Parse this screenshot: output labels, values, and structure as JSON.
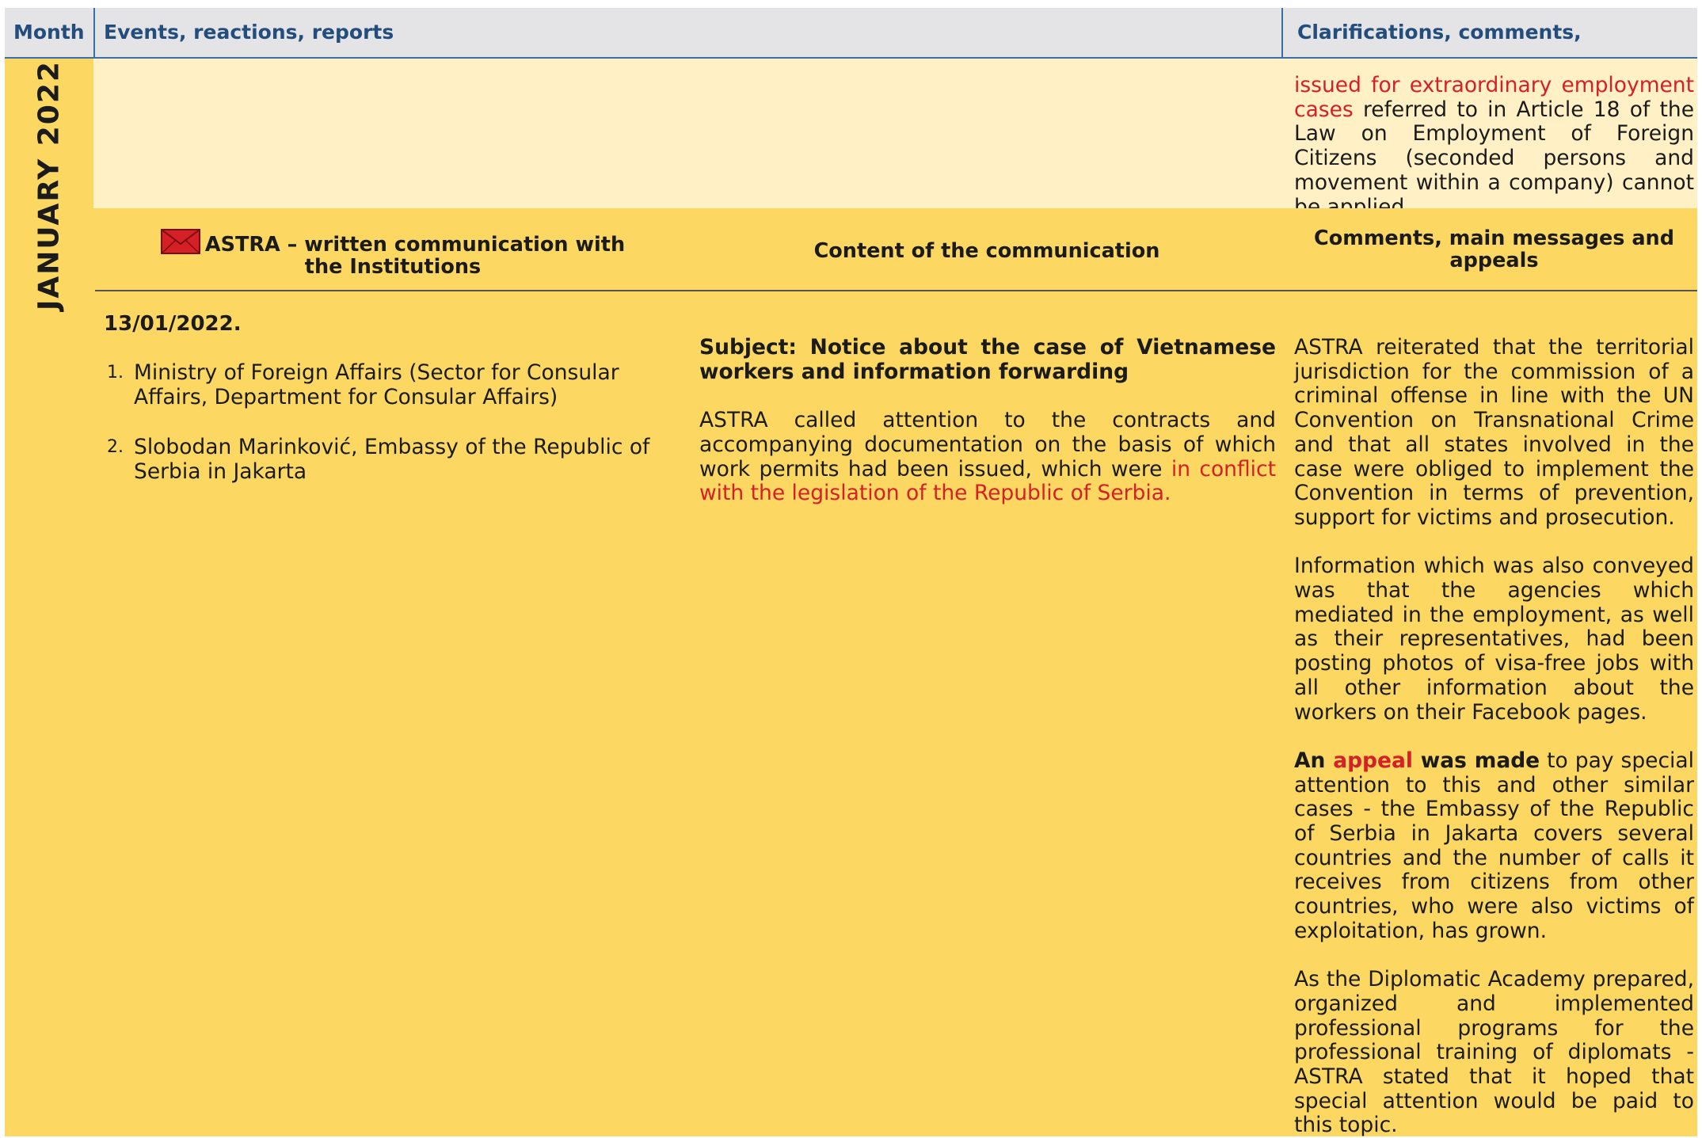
{
  "header": {
    "month": "Month",
    "events": "Events, reactions, reports",
    "clarifications": "Clarifications, comments, responses"
  },
  "month_label": "JANUARY 2022",
  "continuation": {
    "red_text": "issued for extraordinary employment cases",
    "rest_text": " referred to in Article 18 of the Law on Employment of Foreign Citizens (seconded persons and movement within a company) cannot be applied."
  },
  "subheader": {
    "col1": "ASTRA – written communication with the Institutions",
    "col2": "Content of the communication",
    "col3": "Comments, main messages and appeals",
    "icon": "envelope-icon",
    "icon_color": "#d62027"
  },
  "entry": {
    "date": "13/01/2022.",
    "institutions": [
      {
        "num": "1.",
        "text": "Ministry of Foreign Affairs (Sector for Consular Affairs, Department for Consular Affairs)"
      },
      {
        "num": "2.",
        "text": "Slobodan Marinković, Embassy of the Republic of Serbia in Jakarta"
      }
    ],
    "subject": "Subject: Notice about the case of Vietnamese workers and information forwarding",
    "content_text": "ASTRA called attention to the contracts and accompanying documentation on the basis of which work permits had been issued, which were ",
    "content_red": "in conflict with the legislation of the Republic of Serbia.",
    "comments": {
      "p1": "ASTRA reiterated that the territorial jurisdiction for the commission of a criminal offense in line with the UN Convention on Transnational Crime and that all states involved in the case were obliged to implement the Convention in terms of prevention, support for victims and prosecution.",
      "p2": "Information which was also conveyed was that the agencies which mediated in the employment, as well as their representatives, had been posting photos of visa-free jobs with all other information about the workers on their Facebook pages.",
      "p3_bold1": "An ",
      "p3_red": "appeal",
      "p3_bold2": " was made",
      "p3_rest": " to pay special attention to this and other similar cases - the Embassy of the Republic of Serbia in Jakarta covers several countries and the number of calls it receives from citizens from other countries, who were also victims of exploitation, has grown.",
      "p4": "As the Diplomatic Academy prepared, organized and implemented professional programs for the professional training of diplomats - ASTRA stated that it hoped that special attention would be paid to this topic."
    }
  },
  "colors": {
    "header_bg": "#e4e4e6",
    "header_text": "#234d7d",
    "accent_line": "#3a6fa8",
    "yellow": "#fcd863",
    "pale_yellow": "#fff0c6",
    "red_text": "#d62027"
  }
}
